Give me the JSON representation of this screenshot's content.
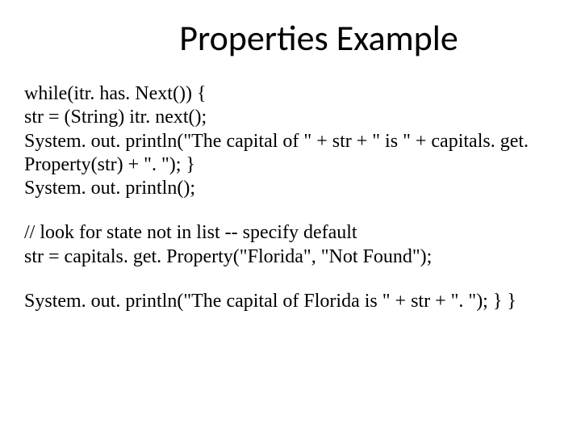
{
  "title": "Properties Example",
  "code": {
    "l1": "while(itr. has. Next()) {",
    "l2": "str = (String) itr. next();",
    "l3": "System. out. println(\"The capital of \" + str + \" is \" + capitals. get. Property(str) + \". \"); }",
    "l4": "System. out. println();",
    "l5": "// look for state not in list -- specify default",
    "l6": "str = capitals. get. Property(\"Florida\", \"Not Found\");",
    "l7": "System. out. println(\"The capital of Florida is \" + str + \". \"); } }"
  }
}
